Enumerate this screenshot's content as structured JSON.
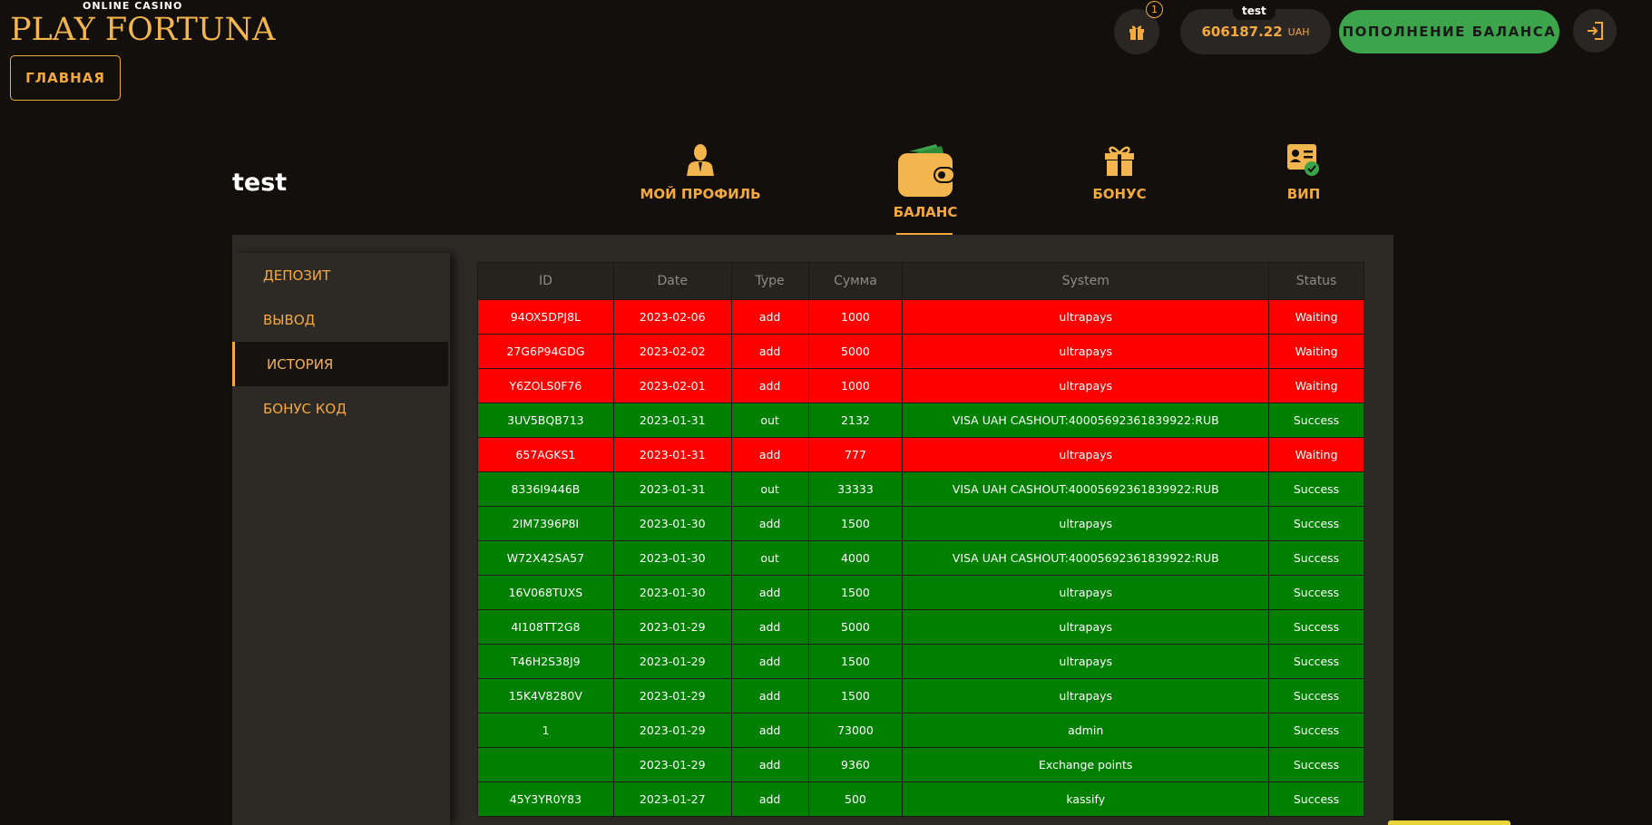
{
  "header": {
    "logo_top": "ONLINE CASINO",
    "logo_main": "PLAY FORTUNA",
    "home_label": "ГЛАВНАЯ",
    "gift_badge": "1",
    "username_tag": "test",
    "balance_amount": "606187.22",
    "balance_currency": "UAH",
    "topup_label": "ПОПОЛНЕНИЕ БАЛАНСА"
  },
  "profile": {
    "username": "test",
    "tabs": [
      {
        "label": "МОЙ ПРОФИЛЬ",
        "icon": "user-icon"
      },
      {
        "label": "БАЛАНС",
        "icon": "wallet-icon",
        "active": true
      },
      {
        "label": "БОНУС",
        "icon": "gift-icon"
      },
      {
        "label": "ВИП",
        "icon": "vip-card-icon"
      }
    ]
  },
  "sidebar": {
    "items": [
      {
        "label": "ДЕПОЗИТ"
      },
      {
        "label": "ВЫВОД"
      },
      {
        "label": "ИСТОРИЯ",
        "active": true
      },
      {
        "label": "БОНУС КОД"
      }
    ]
  },
  "table": {
    "headers": [
      "ID",
      "Date",
      "Type",
      "Сумма",
      "System",
      "Status"
    ],
    "rows": [
      [
        "94OX5DPJ8L",
        "2023-02-06",
        "add",
        "1000",
        "ultrapays",
        "Waiting"
      ],
      [
        "27G6P94GDG",
        "2023-02-02",
        "add",
        "5000",
        "ultrapays",
        "Waiting"
      ],
      [
        "Y6ZOLS0F76",
        "2023-02-01",
        "add",
        "1000",
        "ultrapays",
        "Waiting"
      ],
      [
        "3UV5BQB713",
        "2023-01-31",
        "out",
        "2132",
        "VISA UAH CASHOUT:40005692361839922:RUB",
        "Success"
      ],
      [
        "657AGKS1",
        "2023-01-31",
        "add",
        "777",
        "ultrapays",
        "Waiting"
      ],
      [
        "8336I9446B",
        "2023-01-31",
        "out",
        "33333",
        "VISA UAH CASHOUT:40005692361839922:RUB",
        "Success"
      ],
      [
        "2IM7396P8I",
        "2023-01-30",
        "add",
        "1500",
        "ultrapays",
        "Success"
      ],
      [
        "W72X42SA57",
        "2023-01-30",
        "out",
        "4000",
        "VISA UAH CASHOUT:40005692361839922:RUB",
        "Success"
      ],
      [
        "16V068TUXS",
        "2023-01-30",
        "add",
        "1500",
        "ultrapays",
        "Success"
      ],
      [
        "4I108TT2G8",
        "2023-01-29",
        "add",
        "5000",
        "ultrapays",
        "Success"
      ],
      [
        "T46H2S38J9",
        "2023-01-29",
        "add",
        "1500",
        "ultrapays",
        "Success"
      ],
      [
        "15K4V8280V",
        "2023-01-29",
        "add",
        "1500",
        "ultrapays",
        "Success"
      ],
      [
        "1",
        "2023-01-29",
        "add",
        "73000",
        "admin",
        "Success"
      ],
      [
        "",
        "2023-01-29",
        "add",
        "9360",
        "Exchange points",
        "Success"
      ],
      [
        "45Y3YR0Y83",
        "2023-01-27",
        "add",
        "500",
        "kassify",
        "Success"
      ]
    ]
  },
  "colors": {
    "accent": "#f3a93e",
    "waiting": "#ff0000",
    "success": "#008000",
    "topup": "#3ca44a"
  }
}
